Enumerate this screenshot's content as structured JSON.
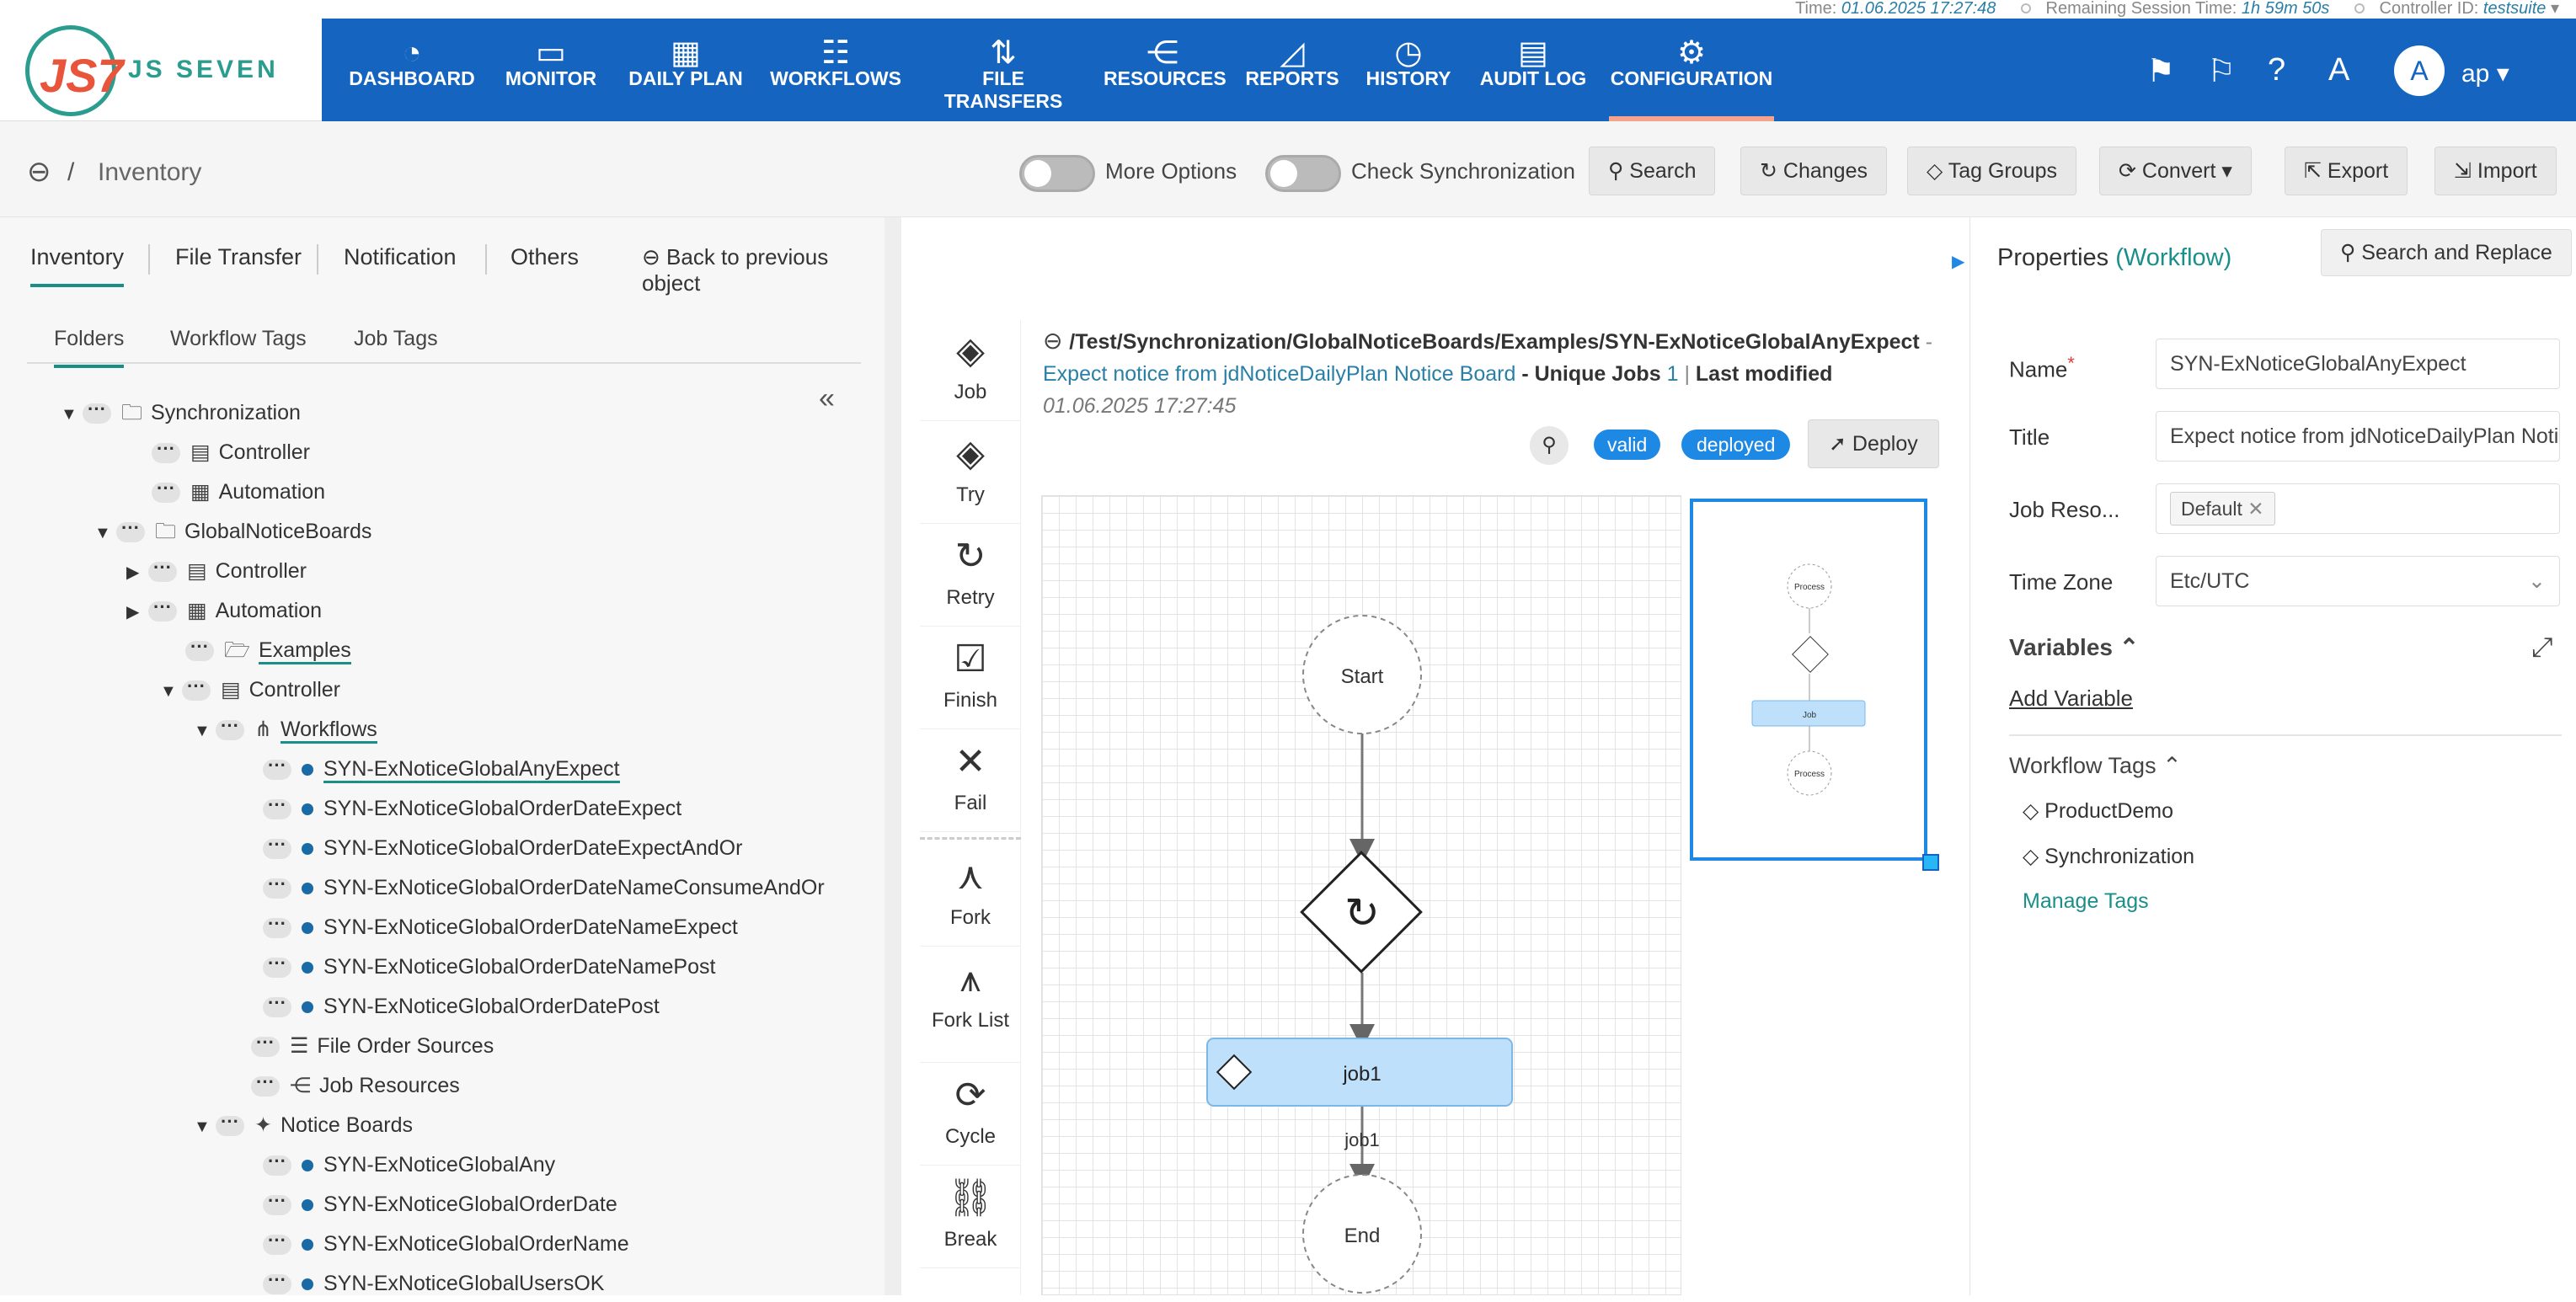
{
  "topbar": {
    "time_label": "Time:",
    "time_value": "01.06.2025 17:27:48",
    "session_label": "Remaining Session Time:",
    "session_value": "1h 59m 50s",
    "controller_label": "Controller ID:",
    "controller_value": "testsuite"
  },
  "logo": {
    "mark": "JS7",
    "name": "JS SEVEN"
  },
  "nav": [
    {
      "label": "DASHBOARD",
      "icon": "◔"
    },
    {
      "label": "MONITOR",
      "icon": "▭"
    },
    {
      "label": "DAILY PLAN",
      "icon": "▦"
    },
    {
      "label": "WORKFLOWS",
      "icon": "☷"
    },
    {
      "label": "FILE TRANSFERS",
      "icon": "⇅"
    },
    {
      "label": "RESOURCES",
      "icon": "⋲"
    },
    {
      "label": "REPORTS",
      "icon": "◿"
    },
    {
      "label": "HISTORY",
      "icon": "◷"
    },
    {
      "label": "AUDIT LOG",
      "icon": "▤"
    },
    {
      "label": "CONFIGURATION",
      "icon": "⚙"
    }
  ],
  "user": {
    "initial": "A",
    "name": "ap"
  },
  "breadcrumb": {
    "back": "⊖",
    "sep": "/",
    "title": "Inventory"
  },
  "toolbar": {
    "more_options": "More Options",
    "check_sync": "Check Synchronization",
    "search": "Search",
    "changes": "Changes",
    "tag_groups": "Tag Groups",
    "convert": "Convert",
    "export": "Export",
    "import": "Import"
  },
  "left_tabs": [
    "Inventory",
    "File Transfer",
    "Notification",
    "Others"
  ],
  "back_to_prev": "Back to previous object",
  "sub_tabs": [
    "Folders",
    "Workflow Tags",
    "Job Tags"
  ],
  "tree": [
    {
      "label": "Synchronization",
      "arrow": "▼",
      "icon": "folder"
    },
    {
      "label": "Controller",
      "arrow": "",
      "icon": "doc"
    },
    {
      "label": "Automation",
      "arrow": "",
      "icon": "cal"
    },
    {
      "label": "GlobalNoticeBoards",
      "arrow": "▼",
      "icon": "folder"
    },
    {
      "label": "Controller",
      "arrow": "▶",
      "icon": "doc"
    },
    {
      "label": "Automation",
      "arrow": "▶",
      "icon": "cal"
    },
    {
      "label": "Examples",
      "arrow": "",
      "icon": "folder-open"
    },
    {
      "label": "Controller",
      "arrow": "▼",
      "icon": "doc"
    },
    {
      "label": "Workflows",
      "arrow": "▼",
      "icon": "tree"
    },
    {
      "label": "SYN-ExNoticeGlobalAnyExpect",
      "arrow": "",
      "icon": "bullet"
    },
    {
      "label": "SYN-ExNoticeGlobalOrderDateExpect",
      "arrow": "",
      "icon": "bullet"
    },
    {
      "label": "SYN-ExNoticeGlobalOrderDateExpectAndOr",
      "arrow": "",
      "icon": "bullet"
    },
    {
      "label": "SYN-ExNoticeGlobalOrderDateNameConsumeAndOr",
      "arrow": "",
      "icon": "bullet"
    },
    {
      "label": "SYN-ExNoticeGlobalOrderDateNameExpect",
      "arrow": "",
      "icon": "bullet"
    },
    {
      "label": "SYN-ExNoticeGlobalOrderDateNamePost",
      "arrow": "",
      "icon": "bullet"
    },
    {
      "label": "SYN-ExNoticeGlobalOrderDatePost",
      "arrow": "",
      "icon": "bullet"
    },
    {
      "label": "File Order Sources",
      "arrow": "",
      "icon": "list"
    },
    {
      "label": "Job Resources",
      "arrow": "",
      "icon": "share"
    },
    {
      "label": "Notice Boards",
      "arrow": "▼",
      "icon": "pin"
    },
    {
      "label": "SYN-ExNoticeGlobalAny",
      "arrow": "",
      "icon": "bullet"
    },
    {
      "label": "SYN-ExNoticeGlobalOrderDate",
      "arrow": "",
      "icon": "bullet"
    },
    {
      "label": "SYN-ExNoticeGlobalOrderName",
      "arrow": "",
      "icon": "bullet"
    },
    {
      "label": "SYN-ExNoticeGlobalUsersOK",
      "arrow": "",
      "icon": "bullet"
    }
  ],
  "palette": [
    {
      "label": "Job",
      "icon": "◈"
    },
    {
      "label": "Try",
      "icon": "◈"
    },
    {
      "label": "Retry",
      "icon": "↻"
    },
    {
      "label": "Finish",
      "icon": "☑"
    },
    {
      "label": "Fail",
      "icon": "✕"
    },
    {
      "label": "Fork",
      "icon": "⋏"
    },
    {
      "label": "Fork List",
      "icon": "⩚"
    },
    {
      "label": "Cycle",
      "icon": "⟳"
    },
    {
      "label": "Break",
      "icon": "⛓"
    }
  ],
  "workflow": {
    "path": "/Test/Synchronization/GlobalNoticeBoards/Examples/SYN-ExNoticeGlobalAnyExpect",
    "dash": "-",
    "title": "Expect notice from jdNoticeDailyPlan Notice Board",
    "unique_jobs_label": "- Unique Jobs",
    "unique_jobs_value": "1",
    "last_modified_label": "Last modified",
    "last_modified_value": "01.06.2025 17:27:45",
    "badge_valid": "valid",
    "badge_deployed": "deployed",
    "deploy": "Deploy"
  },
  "diagram": {
    "start": "Start",
    "job": "job1",
    "edge_label": "job1",
    "end": "End"
  },
  "minimap": {
    "top": "Process",
    "job": "Job",
    "bottom": "Process"
  },
  "properties": {
    "heading": "Properties",
    "type": "(Workflow)",
    "search_replace": "Search and Replace",
    "name_label": "Name",
    "name_value": "SYN-ExNoticeGlobalAnyExpect",
    "title_label": "Title",
    "title_value": "Expect notice from jdNoticeDailyPlan Notice Board",
    "jobres_label": "Job Reso...",
    "jobres_value": "Default",
    "tz_label": "Time Zone",
    "tz_value": "Etc/UTC",
    "variables": "Variables",
    "add_variable": "Add Variable",
    "workflow_tags": "Workflow Tags",
    "tags": [
      "ProductDemo",
      "Synchronization"
    ],
    "manage_tags": "Manage Tags"
  },
  "colors": {
    "header": "#1565c0",
    "accent": "#1a8f8a",
    "badge": "#1e88e5"
  }
}
